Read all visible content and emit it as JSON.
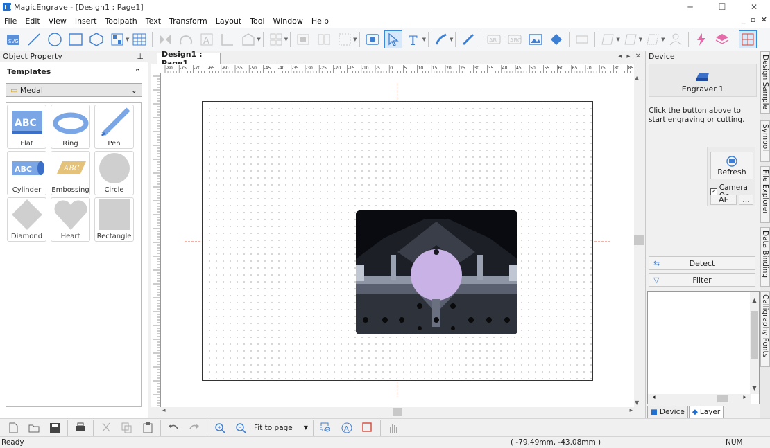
{
  "window": {
    "title": "MagicEngrave - [Design1 : Page1]"
  },
  "menu": [
    "File",
    "Edit",
    "View",
    "Insert",
    "Toolpath",
    "Text",
    "Transform",
    "Layout",
    "Tool",
    "Window",
    "Help"
  ],
  "left_panel": {
    "title": "Object Property",
    "templates_label": "Templates",
    "category": "Medal",
    "items": [
      "Flat",
      "Ring",
      "Pen",
      "Cylinder",
      "Embossing",
      "Circle",
      "Diamond",
      "Heart",
      "Rectangle"
    ]
  },
  "document": {
    "tab": "Design1 : Page1",
    "ruler_h": [
      "-80",
      "-75",
      "-70",
      "-65",
      "-60",
      "-55",
      "-50",
      "-45",
      "-40",
      "-35",
      "-30",
      "-25",
      "-20",
      "-15",
      "-10",
      "-5",
      "0",
      "5",
      "10",
      "15",
      "20",
      "25",
      "30",
      "35",
      "40",
      "45",
      "50",
      "55",
      "60",
      "65",
      "70",
      "75",
      "80",
      "85"
    ]
  },
  "right_panel": {
    "title": "Device",
    "engraver_label": "Engraver 1",
    "hint": "Click the button above to start engraving or cutting.",
    "refresh": "Refresh",
    "camera_on": "Camera On",
    "af": "AF",
    "more": "...",
    "detect": "Detect",
    "filter": "Filter",
    "tab_device": "Device",
    "tab_layer": "Layer"
  },
  "side_tabs": [
    "Design Sample",
    "Symbol",
    "File Explorer",
    "Data Binding",
    "Calligraphy Fonts"
  ],
  "bottom_toolbar": {
    "zoom": "Fit to page"
  },
  "status": {
    "left": "Ready",
    "coords": "( -79.49mm, -43.08mm )",
    "num": "NUM"
  },
  "colors": {
    "accent": "#3a8ad8",
    "guide": "#f4b1a4",
    "medal": "#c8b2e6"
  }
}
